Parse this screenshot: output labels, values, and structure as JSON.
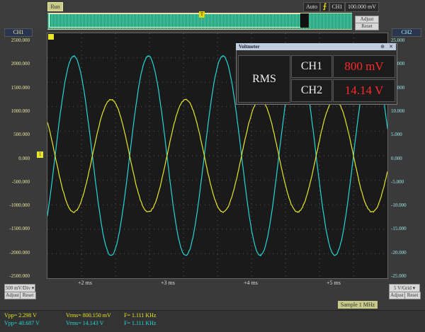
{
  "top": {
    "run_label": "Run",
    "auto_label": "Auto",
    "trigger_icon": "trigger-edge-icon",
    "trigger_channel": "CH1",
    "trigger_level": "100.000 mV",
    "adjust_label": "Adjust",
    "reset_label": "Reset",
    "t_marker": "T"
  },
  "ch1": {
    "header": "CH1",
    "yticks": [
      "2500.000",
      "2000.000",
      "1500.000",
      "1000.000",
      "500.000",
      "0.000",
      "-500.000",
      "-1000.000",
      "-1500.000",
      "-2000.000",
      "-2500.000"
    ],
    "scale": "500 mV/Div",
    "adjust_label": "Adjust",
    "reset_label": "Reset",
    "marker": "1",
    "color": "#e6e62a"
  },
  "ch2": {
    "header": "CH2",
    "yticks": [
      "25.000",
      "20.000",
      "15.000",
      "10.000",
      "5.000",
      "0.000",
      "-5.000",
      "-10.000",
      "-15.000",
      "-20.000",
      "-25.000"
    ],
    "scale": "5 V/Grid",
    "adjust_label": "Adjust",
    "reset_label": "Reset",
    "color": "#25d6d6"
  },
  "xaxis": {
    "ticks": [
      "+2 ms",
      "+3 ms",
      "+4 ms",
      "+5 ms"
    ]
  },
  "sample": "Sample 1 MHz",
  "measurements": [
    {
      "vpp": "Vpp= 2.298 V",
      "vrms": "Vrms= 800.150 mV",
      "freq": "F= 1.111 KHz",
      "color": "#e6e62a"
    },
    {
      "vpp": "Vpp= 40.687 V",
      "vrms": "Vrms= 14.143 V",
      "freq": "F= 1.111 KHz",
      "color": "#25d6d6"
    }
  ],
  "voltmeter": {
    "title": "Voltmeter",
    "rms_label": "RMS",
    "rows": [
      {
        "channel": "CH1",
        "value": "800 mV"
      },
      {
        "channel": "CH2",
        "value": "14.14 V"
      }
    ]
  },
  "waveforms": [
    {
      "channel": "CH1",
      "amplitude_mV": 1149,
      "frequency_kHz": 1.111,
      "phase_deg": 0
    },
    {
      "channel": "CH2",
      "amplitude_V": 20.34,
      "frequency_kHz": 1.111,
      "phase_deg": 180
    }
  ]
}
